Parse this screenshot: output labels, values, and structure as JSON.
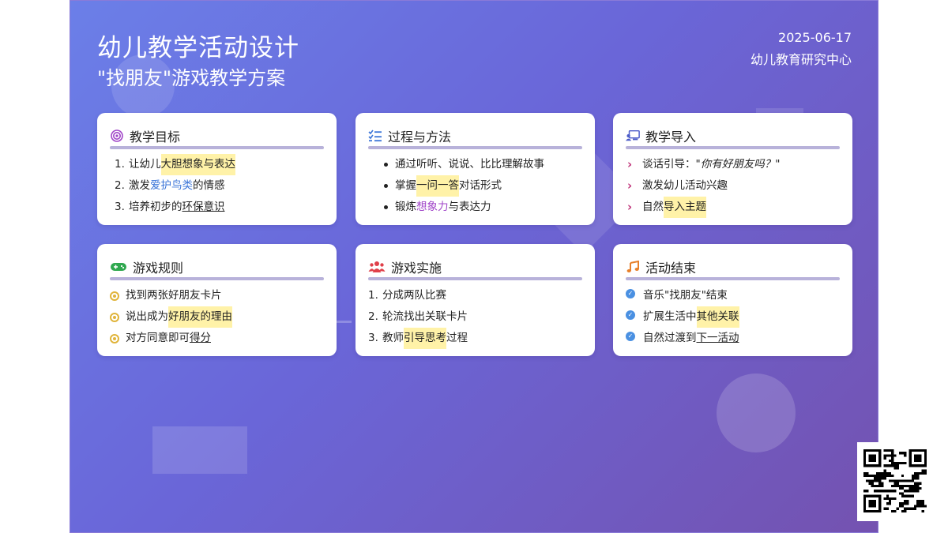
{
  "header": {
    "title": "幼儿教学活动设计",
    "subtitle": "\"找朋友\"游戏教学方案",
    "date": "2025-06-17",
    "org": "幼儿教育研究中心"
  },
  "colors": {
    "accent_purple": "#a045c8",
    "accent_blue": "#3a74d8",
    "highlight": "#fff2a8"
  },
  "cards": {
    "goals": {
      "icon": "target-icon",
      "title": "教学目标",
      "items": [
        {
          "num": "1.",
          "pre": "让幼儿",
          "hl": "大胆想象与表达",
          "post": ""
        },
        {
          "num": "2.",
          "pre": "激发",
          "hl": "爱护鸟类",
          "post": "的情感"
        },
        {
          "num": "3.",
          "pre": "培养初步的",
          "hl": "环保意识",
          "post": ""
        }
      ]
    },
    "process": {
      "icon": "checklist-icon",
      "title": "过程与方法",
      "items": [
        {
          "pre": "通过听听、说说、比比理解故事",
          "hl": "",
          "post": ""
        },
        {
          "pre": "掌握",
          "hl": "一问一答",
          "post": "对话形式"
        },
        {
          "pre": "锻炼",
          "hl": "想象力",
          "post": "与表达力"
        }
      ]
    },
    "intro": {
      "icon": "teacher-board-icon",
      "title": "教学导入",
      "items": [
        {
          "pre": "谈话引导：\"",
          "hl": "你有好朋友吗？",
          "post": "\""
        },
        {
          "pre": "激发幼儿活动兴趣",
          "hl": "",
          "post": ""
        },
        {
          "pre": "自然",
          "hl": "导入主题",
          "post": ""
        }
      ]
    },
    "rules": {
      "icon": "gamepad-icon",
      "title": "游戏规则",
      "items": [
        {
          "pre": "找到两张好朋友卡片",
          "hl": "",
          "post": ""
        },
        {
          "pre": "说出成为",
          "hl": "好朋友的理由",
          "post": ""
        },
        {
          "pre": "对方同意即可",
          "hl": "得分",
          "post": ""
        }
      ]
    },
    "implement": {
      "icon": "users-icon",
      "title": "游戏实施",
      "items": [
        {
          "num": "1.",
          "pre": "分成两队比赛",
          "hl": "",
          "post": ""
        },
        {
          "num": "2.",
          "pre": "轮流找出关联卡片",
          "hl": "",
          "post": ""
        },
        {
          "num": "3.",
          "pre": "教师",
          "hl": "引导思考",
          "post": "过程"
        }
      ]
    },
    "ending": {
      "icon": "music-icon",
      "title": "活动结束",
      "items": [
        {
          "pre": "音乐\"找朋友\"结束",
          "hl": "",
          "post": ""
        },
        {
          "pre": "扩展生活中",
          "hl": "其他关联",
          "post": ""
        },
        {
          "pre": "自然过渡到",
          "hl": "下一活动",
          "post": ""
        }
      ]
    }
  },
  "qr": {
    "icon": "qr-code-icon"
  }
}
